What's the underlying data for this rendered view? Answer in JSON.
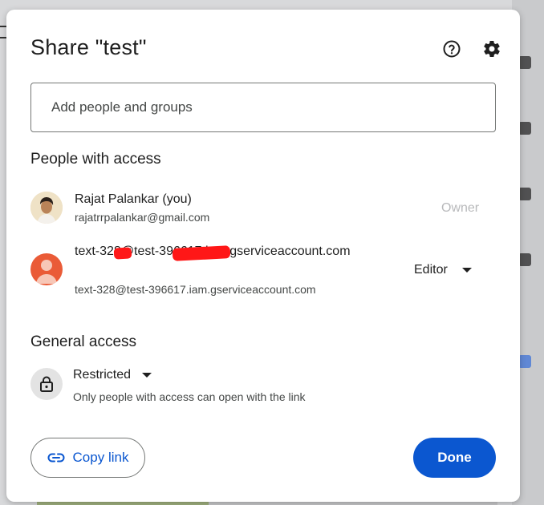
{
  "dialog": {
    "title": "Share \"test\"",
    "help_icon": "help-circle-icon",
    "settings_icon": "gear-icon"
  },
  "add_people": {
    "placeholder": "Add people and groups",
    "value": ""
  },
  "people_with_access": {
    "heading": "People with access",
    "people": [
      {
        "name": "Rajat Palankar (you)",
        "email": "rajatrrpalankar@gmail.com",
        "role": "Owner",
        "avatar": "profile-photo"
      },
      {
        "name": "text-328@test-396617.iam.gserviceaccount.com",
        "email": "text-328@test-396617.iam.gserviceaccount.com",
        "role": "Editor",
        "avatar": "generic-person-icon"
      }
    ]
  },
  "general_access": {
    "heading": "General access",
    "access_level": "Restricted",
    "description": "Only people with access can open with the link",
    "icon": "lock-icon"
  },
  "actions": {
    "copy_link_label": "Copy link",
    "copy_link_icon": "link-icon",
    "done_label": "Done"
  },
  "colors": {
    "primary": "#0b57d0",
    "text": "#1f1f1f",
    "secondary_text": "#444746",
    "avatar_orange": "#ea5b37"
  }
}
